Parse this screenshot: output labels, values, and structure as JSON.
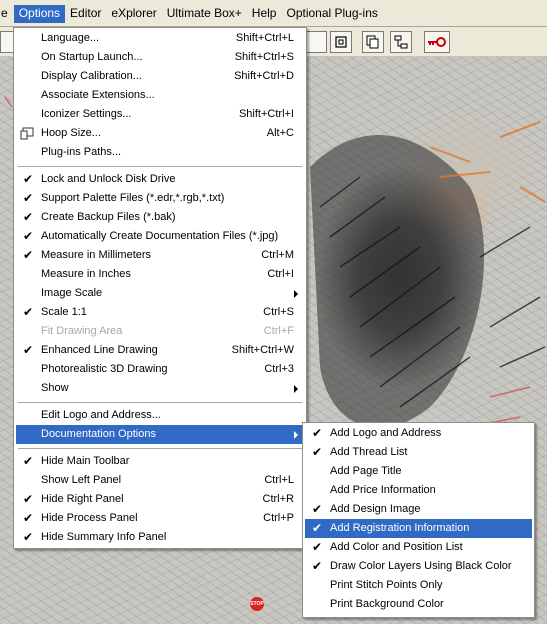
{
  "menubar": {
    "items": [
      "e",
      "Options",
      "Editor",
      "eXplorer",
      "Ultimate Box+",
      "Help",
      "Optional Plug-ins"
    ]
  },
  "options_menu": {
    "items": [
      {
        "label": "Language...",
        "shortcut": "Shift+Ctrl+L",
        "checked": false
      },
      {
        "label": "On Startup Launch...",
        "shortcut": "Shift+Ctrl+S",
        "checked": false
      },
      {
        "label": "Display Calibration...",
        "shortcut": "Shift+Ctrl+D",
        "checked": false
      },
      {
        "label": "Associate Extensions...",
        "shortcut": "",
        "checked": false
      },
      {
        "label": "Iconizer Settings...",
        "shortcut": "Shift+Ctrl+I",
        "checked": false
      },
      {
        "label": "Hoop Size...",
        "shortcut": "Alt+C",
        "checked": false,
        "icon": "hoop-icon"
      },
      {
        "label": "Plug-ins Paths...",
        "shortcut": "",
        "checked": false
      },
      {
        "label": "Lock and Unlock Disk Drive",
        "shortcut": "",
        "checked": true
      },
      {
        "label": "Support Palette Files (*.edr,*.rgb,*.txt)",
        "shortcut": "",
        "checked": true
      },
      {
        "label": "Create Backup Files (*.bak)",
        "shortcut": "",
        "checked": true
      },
      {
        "label": "Automatically Create Documentation Files (*.jpg)",
        "shortcut": "",
        "checked": true
      },
      {
        "label": "Measure in Millimeters",
        "shortcut": "Ctrl+M",
        "checked": true
      },
      {
        "label": "Measure in Inches",
        "shortcut": "Ctrl+I",
        "checked": false
      },
      {
        "label": "Image Scale",
        "shortcut": "",
        "checked": false,
        "submenu": true
      },
      {
        "label": "Scale 1:1",
        "shortcut": "Ctrl+S",
        "checked": true
      },
      {
        "label": "Fit Drawing Area",
        "shortcut": "Ctrl+F",
        "checked": false,
        "disabled": true
      },
      {
        "label": "Enhanced Line Drawing",
        "shortcut": "Shift+Ctrl+W",
        "checked": true
      },
      {
        "label": "Photorealistic 3D Drawing",
        "shortcut": "Ctrl+3",
        "checked": false
      },
      {
        "label": "Show",
        "shortcut": "",
        "checked": false,
        "submenu": true
      },
      {
        "label": "Edit Logo and Address...",
        "shortcut": "",
        "checked": false
      },
      {
        "label": "Documentation Options",
        "shortcut": "",
        "checked": false,
        "submenu": true,
        "highlighted": true
      },
      {
        "label": "Hide Main Toolbar",
        "shortcut": "",
        "checked": true
      },
      {
        "label": "Show Left Panel",
        "shortcut": "Ctrl+L",
        "checked": false
      },
      {
        "label": "Hide Right Panel",
        "shortcut": "Ctrl+R",
        "checked": true
      },
      {
        "label": "Hide Process Panel",
        "shortcut": "Ctrl+P",
        "checked": true
      },
      {
        "label": "Hide Summary Info Panel",
        "shortcut": "",
        "checked": true
      }
    ]
  },
  "documentation_submenu": {
    "items": [
      {
        "label": "Add Logo and Address",
        "checked": true
      },
      {
        "label": "Add Thread List",
        "checked": true
      },
      {
        "label": "Add Page Title",
        "checked": false
      },
      {
        "label": "Add Price Information",
        "checked": false
      },
      {
        "label": "Add Design Image",
        "checked": true
      },
      {
        "label": "Add Registration Information",
        "checked": true,
        "highlighted": true
      },
      {
        "label": "Add Color and Position List",
        "checked": true
      },
      {
        "label": "Draw Color Layers Using Black Color",
        "checked": true
      },
      {
        "label": "Print Stitch Points Only",
        "checked": false
      },
      {
        "label": "Print Background Color",
        "checked": false
      }
    ]
  },
  "checkmark_glyph": "✔",
  "stop_badge": "STOP",
  "colors": {
    "menu_highlight": "#316ac5",
    "menubar_bg": "#ece9d8",
    "disabled_text": "#a7a6aa"
  }
}
